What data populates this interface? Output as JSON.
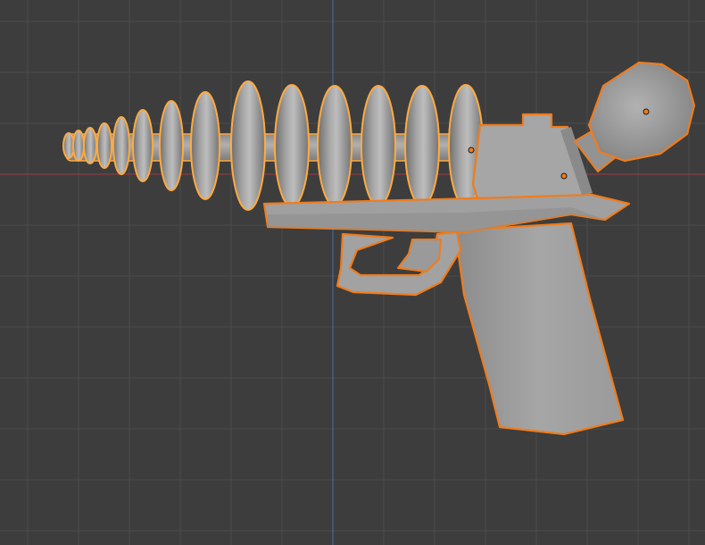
{
  "viewport": {
    "view": "3d-viewport-side-orthographic",
    "background_color": "#3d3d3d",
    "grid_line_color": "#4b4b4b",
    "grid_minor_color": "#444444",
    "x_axis_color": "#9c3a46",
    "z_axis_color": "#4470a6"
  },
  "scene": {
    "object": "raygun-pistol",
    "selection_state": "selected-active",
    "mesh_color": "#9a9a9a",
    "mesh_shadow_color": "#6e6e6e",
    "mesh_highlight_color": "#bdbdbd",
    "outline_active_color": "#ffaa40",
    "outline_selected_color": "#f07c1c",
    "origin_dot_color": "#f07c1c",
    "parts": [
      "barrel-rings",
      "barrel-tube",
      "receiver",
      "frame-slide",
      "trigger-guard",
      "trigger",
      "grip",
      "bulb"
    ]
  }
}
